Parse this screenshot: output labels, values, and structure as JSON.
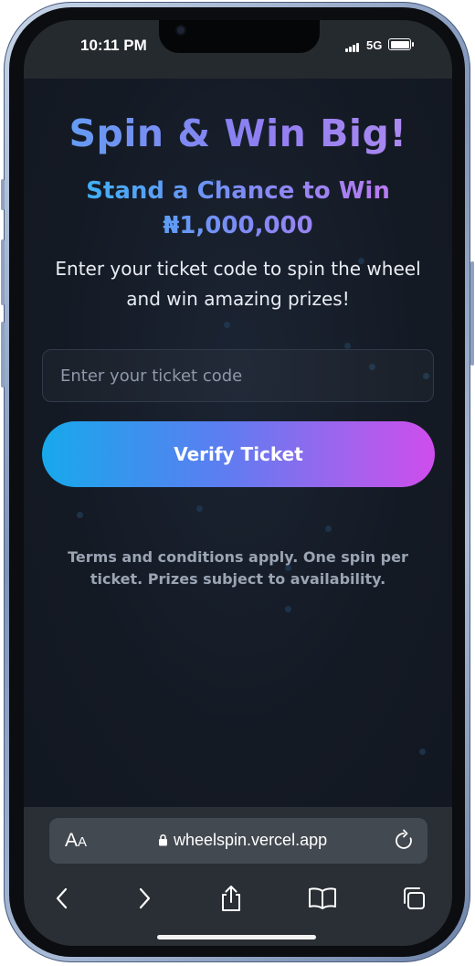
{
  "status_bar": {
    "time": "10:11 PM",
    "network": "5G"
  },
  "hero": {
    "title": "Spin & Win Big!",
    "subtitle": "Stand a Chance to Win ₦1,000,000",
    "description": "Enter your ticket code to spin the wheel and win amazing prizes!"
  },
  "ticket_input": {
    "placeholder": "Enter your ticket code",
    "value": ""
  },
  "verify_button": {
    "label": "Verify Ticket"
  },
  "terms": "Terms and conditions apply. One spin per ticket. Prizes subject to availability.",
  "browser": {
    "reader_label_big": "A",
    "reader_label_small": "A",
    "url": "wheelspin.vercel.app",
    "toolbar_icons": [
      "back-icon",
      "forward-icon",
      "share-icon",
      "bookmarks-icon",
      "tabs-icon"
    ]
  },
  "colors": {
    "background": "#141a24",
    "title_gradient": [
      "#5aa3f3",
      "#b48cf0"
    ],
    "button_gradient": [
      "#17a9ec",
      "#cf4ded"
    ],
    "browser_bar": "#2a2f35"
  }
}
